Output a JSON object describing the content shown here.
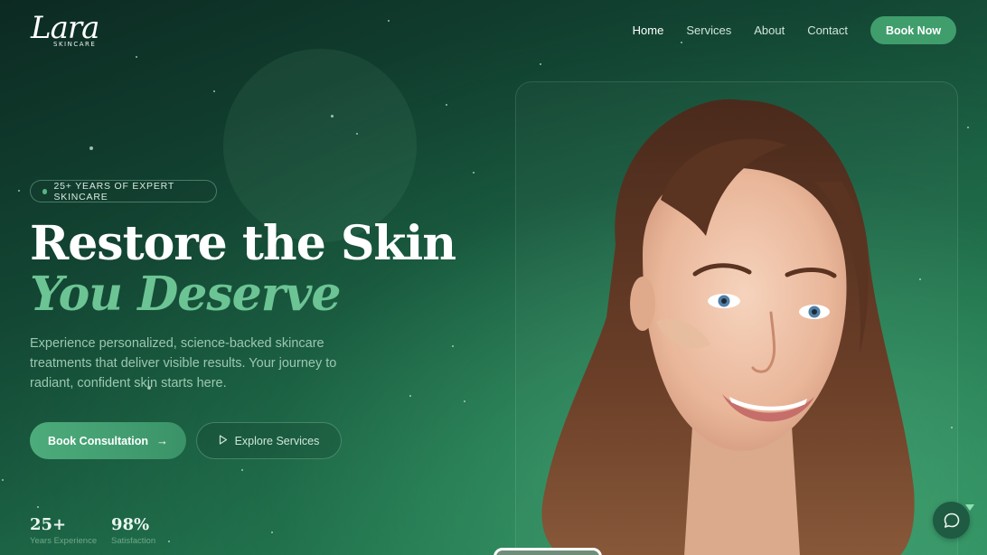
{
  "brand": {
    "script": "Lara",
    "sub": "SKINCARE"
  },
  "nav": {
    "items": [
      {
        "label": "Home",
        "active": true
      },
      {
        "label": "Services",
        "active": false
      },
      {
        "label": "About",
        "active": false
      },
      {
        "label": "Contact",
        "active": false
      }
    ],
    "cta": "Book Now"
  },
  "hero": {
    "badge": "25+ YEARS OF EXPERT SKINCARE",
    "title_line1": "Restore the Skin",
    "title_line2": "You Deserve",
    "description": "Experience personalized, science-backed skincare treatments that deliver visible results. Your journey to radiant, confident skin starts here.",
    "primary_button": "Book Consultation",
    "secondary_button": "Explore Services"
  },
  "stats": [
    {
      "value": "25+",
      "label": "Years Experience"
    },
    {
      "value": "98%",
      "label": "Satisfaction"
    }
  ],
  "icons": {
    "arrow": "arrow-right-icon",
    "play": "play-icon",
    "chat": "chat-bubble-icon"
  },
  "colors": {
    "accent": "#3f9e6c",
    "accent_text": "#6cc494",
    "background_dark": "#0c2a22",
    "background_light": "#2f8a5e"
  }
}
